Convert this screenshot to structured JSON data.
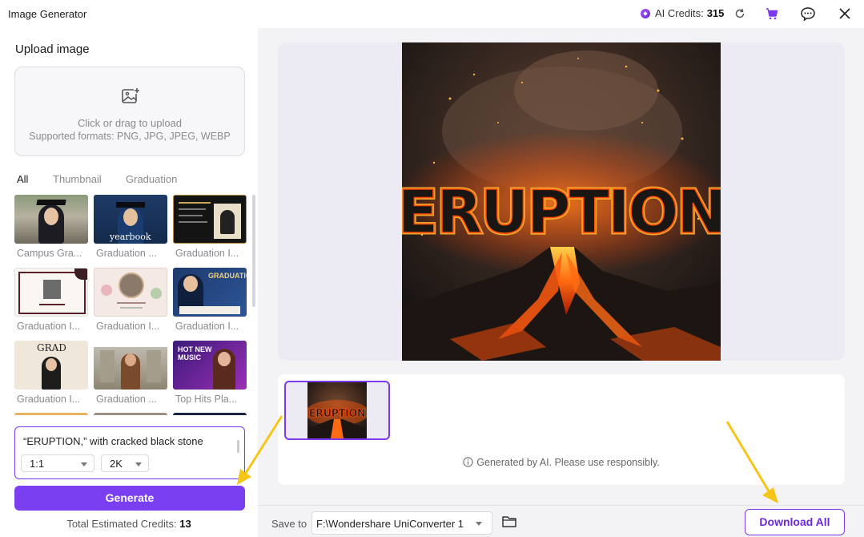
{
  "app": {
    "title": "Image Generator"
  },
  "header": {
    "credits_label": "AI Credits:",
    "credits_value": "315"
  },
  "upload": {
    "heading": "Upload image",
    "line1": "Click or drag to upload",
    "line2": "Supported formats: PNG, JPG, JPEG, WEBP"
  },
  "tabs": [
    {
      "label": "All",
      "active": true
    },
    {
      "label": "Thumbnail",
      "active": false
    },
    {
      "label": "Graduation",
      "active": false
    }
  ],
  "templates": [
    {
      "caption": "Campus Gra..."
    },
    {
      "caption": "Graduation ..."
    },
    {
      "caption": "Graduation I..."
    },
    {
      "caption": "Graduation I..."
    },
    {
      "caption": "Graduation I..."
    },
    {
      "caption": "Graduation I..."
    },
    {
      "caption": "Graduation I..."
    },
    {
      "caption": "Graduation ..."
    },
    {
      "caption": "Top Hits Pla..."
    }
  ],
  "prompt": {
    "text": "“ERUPTION,” with cracked black stone",
    "ratio": "1:1",
    "resolution": "2K"
  },
  "generate_label": "Generate",
  "total": {
    "label": "Total Estimated Credits:",
    "value": "13"
  },
  "preview": {
    "word": "ERUPTION"
  },
  "note": "Generated by AI. Please use responsibly.",
  "save": {
    "label": "Save to",
    "path": "F:\\Wondershare UniConverter 1"
  },
  "download_label": "Download All",
  "colors": {
    "accent": "#7b3ff2",
    "annotation_arrow": "#f5c518"
  }
}
